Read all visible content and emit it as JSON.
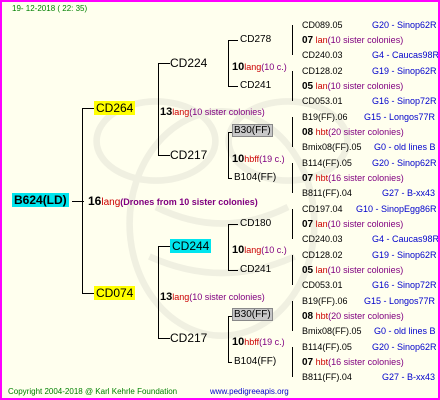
{
  "header": {
    "timestamp": "19- 12-2018 ( 22: 35)"
  },
  "footer": {
    "copyright": "Copyright 2004-2018 @ Karl Kehrle Foundation",
    "site": "www.pedigreeapis.org"
  },
  "root": {
    "id": "B624(LD)",
    "gen": "16",
    "name": "lang",
    "note": "(Drones from 10 sister colonies)"
  },
  "g1": [
    {
      "id": "CD264",
      "gen": "13",
      "name": "lang",
      "note": "(10 sister colonies)"
    },
    {
      "id": "CD074",
      "gen": "13",
      "name": "lang",
      "note": "(10 sister colonies)"
    }
  ],
  "g2": [
    {
      "id": "CD224",
      "gen": "10",
      "name": "lang",
      "note": "(10 c.)"
    },
    {
      "id": "CD217",
      "gen": "10",
      "name": "hbff",
      "note": "(19 c.)"
    },
    {
      "id": "CD244",
      "gen": "10",
      "name": "lang",
      "note": "(10 c.)"
    },
    {
      "id": "CD217",
      "gen": "10",
      "name": "hbff",
      "note": "(19 c.)"
    }
  ],
  "g3": [
    {
      "id": "CD278"
    },
    {
      "id": "CD241"
    },
    {
      "id": "B30(FF)"
    },
    {
      "id": "B104(FF)"
    },
    {
      "id": "CD180"
    },
    {
      "id": "CD241"
    },
    {
      "id": "B30(FF)"
    },
    {
      "id": "B104(FF)"
    }
  ],
  "g4": [
    {
      "a": "CD089.05",
      "b": "G20 - Sinop62R"
    },
    {
      "gen": "07",
      "name": "lan",
      "note": "(10 sister colonies)"
    },
    {
      "a": "CD240.03",
      "b": "G4 - Caucas98R"
    },
    {
      "a": "CD128.02",
      "b": "G19 - Sinop62R"
    },
    {
      "gen": "05",
      "name": "lan",
      "note": "(10 sister colonies)"
    },
    {
      "a": "CD053.01",
      "b": "G16 - Sinop72R"
    },
    {
      "a": "B19(FF).06",
      "b": "G15 - Longos77R"
    },
    {
      "gen": "08",
      "name": "hbt",
      "note": "(20 sister colonies)"
    },
    {
      "a": "Bmix08(FF).05",
      "b": "G0 - old lines B"
    },
    {
      "a": "B114(FF).05",
      "b": "G20 - Sinop62R"
    },
    {
      "gen": "07",
      "name": "hbt",
      "note": "(16 sister colonies)"
    },
    {
      "a": "B811(FF).04",
      "b": "G27 - B-xx43"
    },
    {
      "a": "CD197.04",
      "b": "G10 - SinopEgg86R"
    },
    {
      "gen": "07",
      "name": "lan",
      "note": "(10 sister colonies)"
    },
    {
      "a": "CD240.03",
      "b": "G4 - Caucas98R"
    },
    {
      "a": "CD128.02",
      "b": "G19 - Sinop62R"
    },
    {
      "gen": "05",
      "name": "lan",
      "note": "(10 sister colonies)"
    },
    {
      "a": "CD053.01",
      "b": "G16 - Sinop72R"
    },
    {
      "a": "B19(FF).06",
      "b": "G15 - Longos77R"
    },
    {
      "gen": "08",
      "name": "hbt",
      "note": "(20 sister colonies)"
    },
    {
      "a": "Bmix08(FF).05",
      "b": "G0 - old lines B"
    },
    {
      "a": "B114(FF).05",
      "b": "G20 - Sinop62R"
    },
    {
      "gen": "07",
      "name": "hbt",
      "note": "(16 sister colonies)"
    },
    {
      "a": "B811(FF).04",
      "b": "G27 - B-xx43"
    }
  ]
}
